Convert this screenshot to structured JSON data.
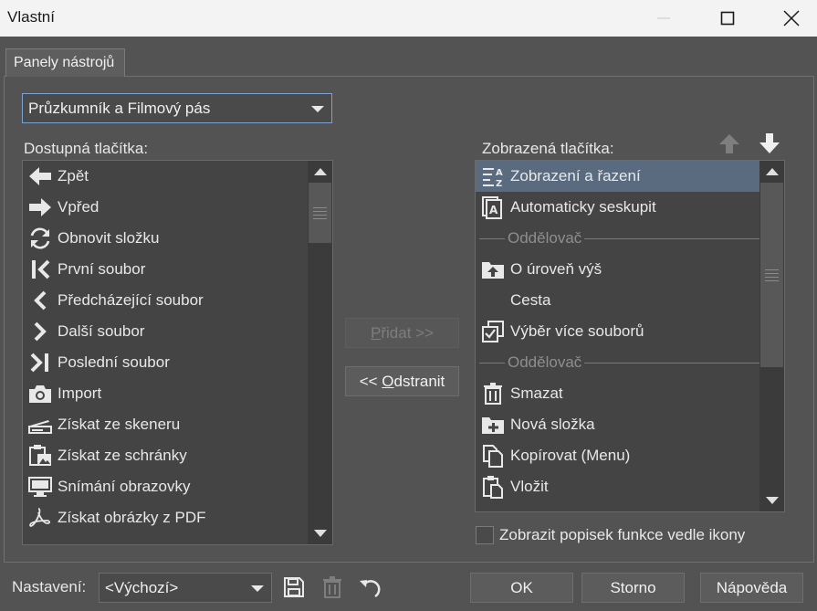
{
  "window": {
    "title": "Vlastní"
  },
  "tab": {
    "label": "Panely nástrojů"
  },
  "toolbar_select": {
    "value": "Průzkumník a Filmový pás"
  },
  "available": {
    "label": "Dostupná tlačítka:",
    "items": [
      {
        "label": "Zpět",
        "icon": "arrow-left-icon"
      },
      {
        "label": "Vpřed",
        "icon": "arrow-right-icon"
      },
      {
        "label": "Obnovit složku",
        "icon": "refresh-icon"
      },
      {
        "label": "První soubor",
        "icon": "first-file-icon"
      },
      {
        "label": "Předcházející soubor",
        "icon": "previous-file-icon"
      },
      {
        "label": "Další soubor",
        "icon": "next-file-icon"
      },
      {
        "label": "Poslední soubor",
        "icon": "last-file-icon"
      },
      {
        "label": "Import",
        "icon": "camera-icon"
      },
      {
        "label": "Získat ze skeneru",
        "icon": "scanner-icon"
      },
      {
        "label": "Získat ze schránky",
        "icon": "clipboard-image-icon"
      },
      {
        "label": "Snímání obrazovky",
        "icon": "monitor-icon"
      },
      {
        "label": "Získat obrázky z PDF",
        "icon": "pdf-icon"
      }
    ]
  },
  "displayed": {
    "label": "Zobrazená tlačítka:",
    "items": [
      {
        "label": "Zobrazení a řazení",
        "icon": "sort-az-icon",
        "selected": true
      },
      {
        "label": "Automaticky seskupit",
        "icon": "auto-group-icon"
      },
      {
        "label": "Oddělovač",
        "separator": true
      },
      {
        "label": "O úroveň výš",
        "icon": "folder-up-icon"
      },
      {
        "label": "Cesta",
        "icon": ""
      },
      {
        "label": "Výběr více souborů",
        "icon": "multi-select-icon"
      },
      {
        "label": "Oddělovač",
        "separator": true
      },
      {
        "label": "Smazat",
        "icon": "trash-icon"
      },
      {
        "label": "Nová složka",
        "icon": "new-folder-icon"
      },
      {
        "label": "Kopírovat (Menu)",
        "icon": "copy-icon"
      },
      {
        "label": "Vložit",
        "icon": "paste-icon"
      }
    ]
  },
  "buttons": {
    "add_label_u": "P",
    "add_label_rest": "řidat >>",
    "remove_label_pre": "<< ",
    "remove_label_u": "O",
    "remove_label_rest": "dstranit",
    "ok": "OK",
    "cancel": "Storno",
    "help": "Nápověda"
  },
  "show_label_checkbox": {
    "label": "Zobrazit popisek funkce vedle ikony",
    "checked": false
  },
  "settings": {
    "label": "Nastavení:",
    "value": "<Výchozí>"
  }
}
